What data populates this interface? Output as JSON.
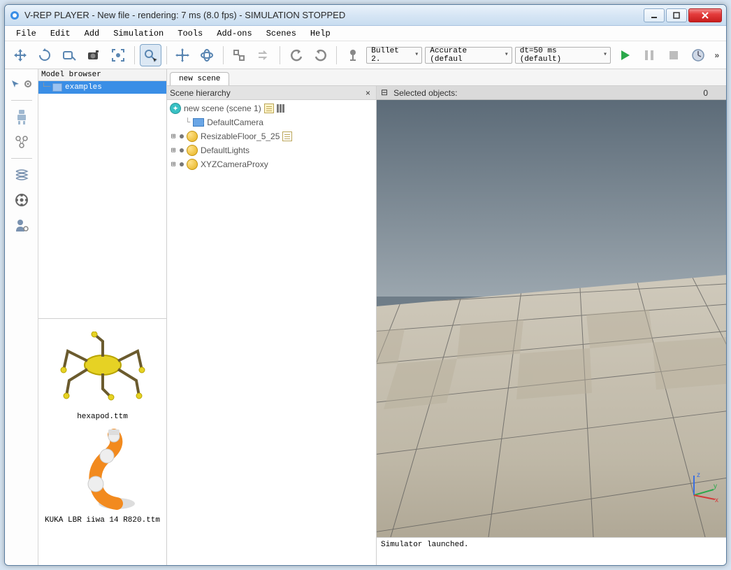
{
  "window": {
    "title": "V-REP PLAYER - New file - rendering: 7 ms (8.0 fps) - SIMULATION STOPPED"
  },
  "menu": {
    "file": "File",
    "edit": "Edit",
    "add": "Add",
    "simulation": "Simulation",
    "tools": "Tools",
    "addons": "Add-ons",
    "scenes": "Scenes",
    "help": "Help"
  },
  "toolbar": {
    "engine": "Bullet 2.",
    "mode": "Accurate (defaul",
    "dt": "dt=50 ms (default)"
  },
  "model_browser": {
    "title": "Model browser",
    "items": [
      "examples"
    ],
    "previews": [
      {
        "name": "hexapod.ttm"
      },
      {
        "name": "KUKA LBR iiwa 14 R820.ttm"
      }
    ]
  },
  "scene_tab": "new scene",
  "hierarchy": {
    "title": "Scene hierarchy",
    "root": "new scene (scene 1)",
    "nodes": [
      "DefaultCamera",
      "ResizableFloor_5_25",
      "DefaultLights",
      "XYZCameraProxy"
    ]
  },
  "selected": {
    "label": "Selected objects:",
    "count": "0"
  },
  "console": {
    "line1": "Simulator launched."
  },
  "axis": {
    "x": "x",
    "y": "y",
    "z": "z"
  }
}
